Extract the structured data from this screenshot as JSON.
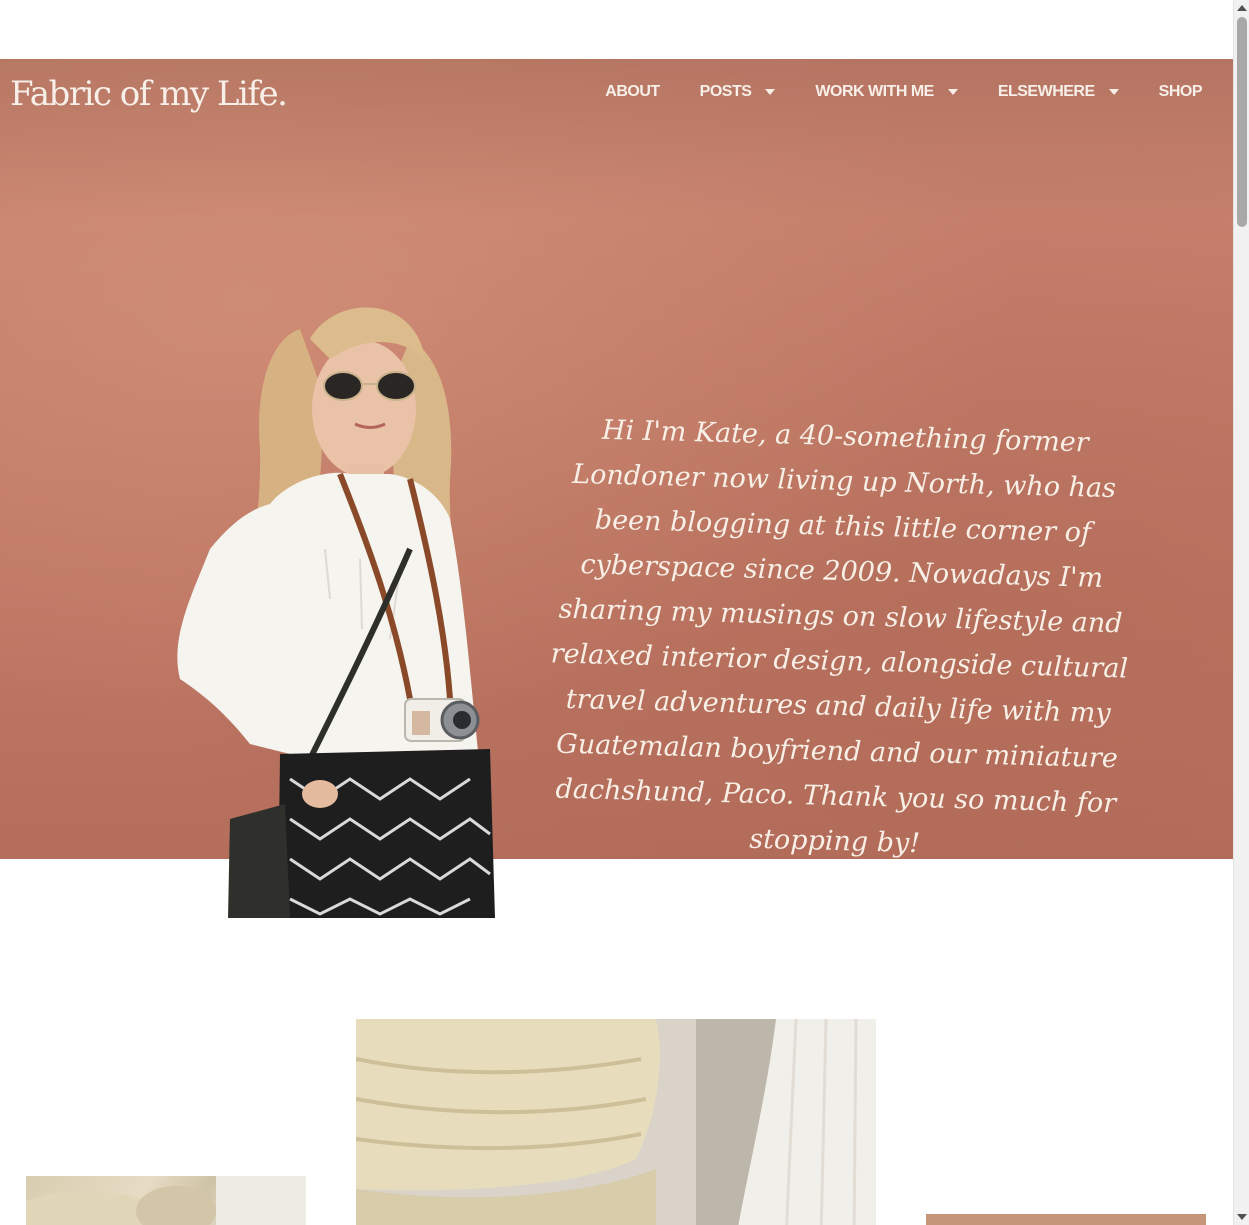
{
  "site": {
    "logo": "Fabric of my Life."
  },
  "nav": {
    "items": [
      {
        "label": "ABOUT",
        "has_dropdown": false
      },
      {
        "label": "POSTS",
        "has_dropdown": true
      },
      {
        "label": "WORK WITH ME",
        "has_dropdown": true
      },
      {
        "label": "ELSEWHERE",
        "has_dropdown": true
      },
      {
        "label": "SHOP",
        "has_dropdown": false
      }
    ]
  },
  "hero": {
    "intro": "Hi I'm Kate, a 40-something former Londoner now living up North, who has been blogging at this little corner of cyberspace since 2009. Nowadays I'm sharing my musings on slow lifestyle and relaxed interior design, alongside cultural travel adventures and daily life with my Guatemalan boyfriend and our miniature dachshund, Paco. Thank you so much for stopping by!"
  },
  "colors": {
    "hero_bg": "#c47d6a",
    "text_light": "#f7efe8"
  }
}
